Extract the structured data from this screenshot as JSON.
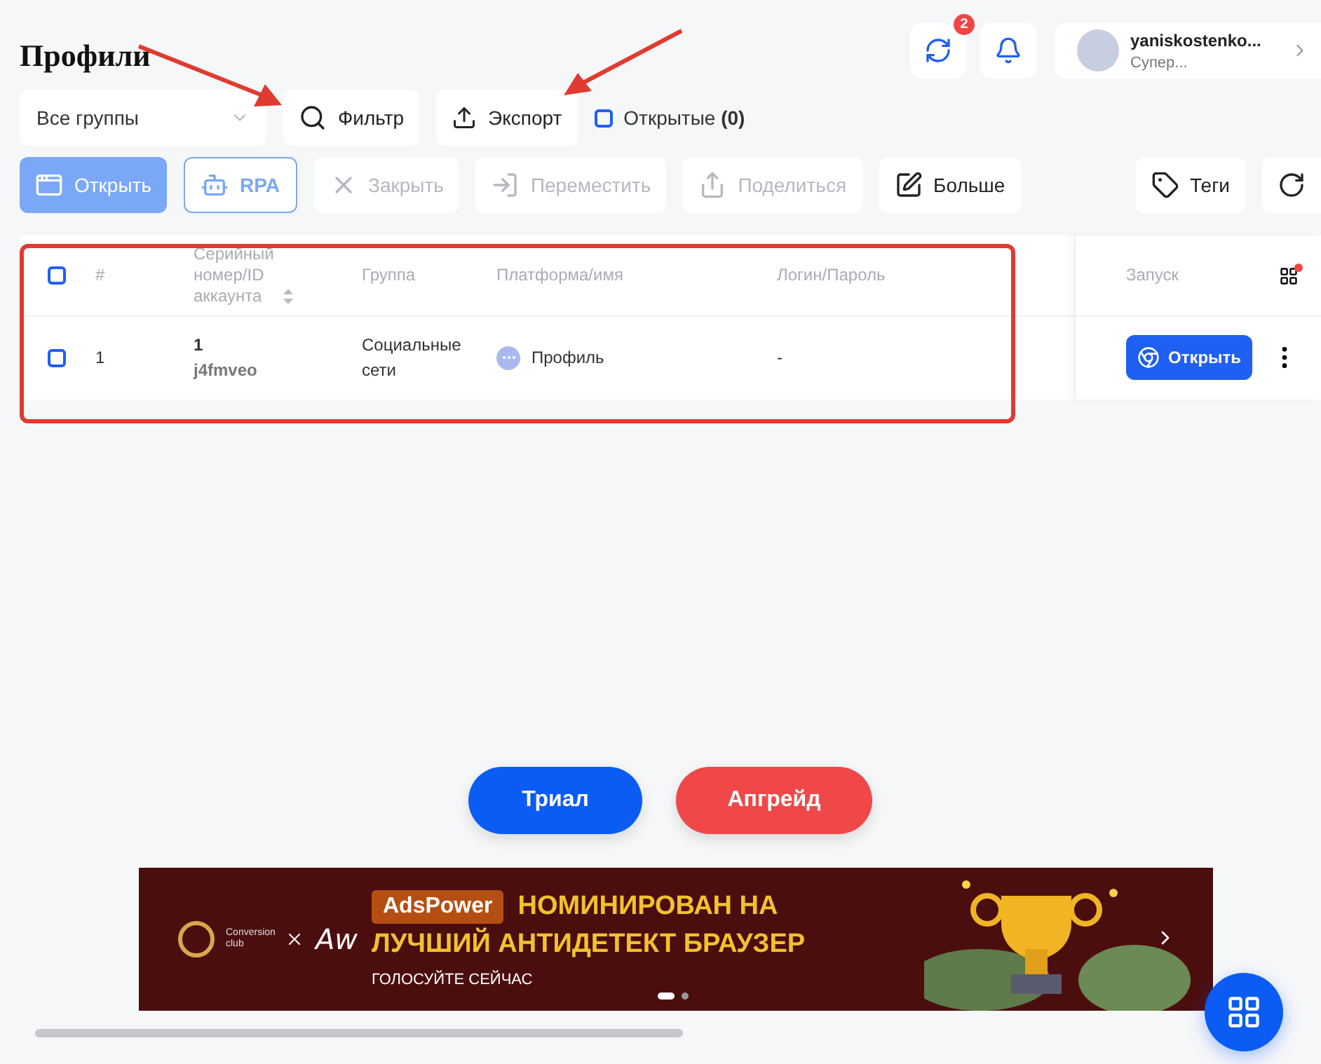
{
  "title": "Профили",
  "header": {
    "sync_badge": "2",
    "user": {
      "name": "yaniskostenko...",
      "role": "Супер..."
    }
  },
  "filters": {
    "group_select": "Все группы",
    "filter_button": "Фильтр",
    "export_button": "Экспорт",
    "opened_only": {
      "label": "Открытые",
      "count": "(0)",
      "checked": false
    }
  },
  "toolbar": [
    {
      "label": "Открыть",
      "kind": "primary",
      "disabled": false
    },
    {
      "label": "RPA",
      "kind": "outline",
      "disabled": false
    },
    {
      "label": "Закрыть",
      "kind": "plain",
      "disabled": true
    },
    {
      "label": "Переместить",
      "kind": "plain",
      "disabled": true
    },
    {
      "label": "Поделиться",
      "kind": "plain",
      "disabled": true
    },
    {
      "label": "Больше",
      "kind": "plain",
      "disabled": false
    }
  ],
  "toolbar_right": {
    "tags": "Теги"
  },
  "table": {
    "all_selected": false,
    "columns": [
      "#",
      "Серийный номер/ID аккаунта",
      "Группа",
      "Платформа/имя",
      "Логин/Пароль",
      "Запуск"
    ],
    "rows": [
      {
        "selected": false,
        "index": "1",
        "serial": "1",
        "account_id": "j4fmveo",
        "group": "Социальные сети",
        "platform": "Профиль",
        "login": "-",
        "launch": "Открыть"
      }
    ]
  },
  "actions": [
    {
      "label": "Триал",
      "kind": "trial"
    },
    {
      "label": "Апгрейд",
      "kind": "upgrade"
    }
  ],
  "banner": {
    "logo": "Conversion club",
    "logo2": "Aw",
    "brand": "AdsPower",
    "line1": "НОМИНИРОВАН НА",
    "line2": "ЛУЧШИЙ АНТИДЕТЕКТ БРАУЗЕР",
    "cta": "ГОЛОСУЙТЕ СЕЙЧАС",
    "slides": [
      {
        "selected": true
      },
      {
        "selected": false
      }
    ]
  }
}
